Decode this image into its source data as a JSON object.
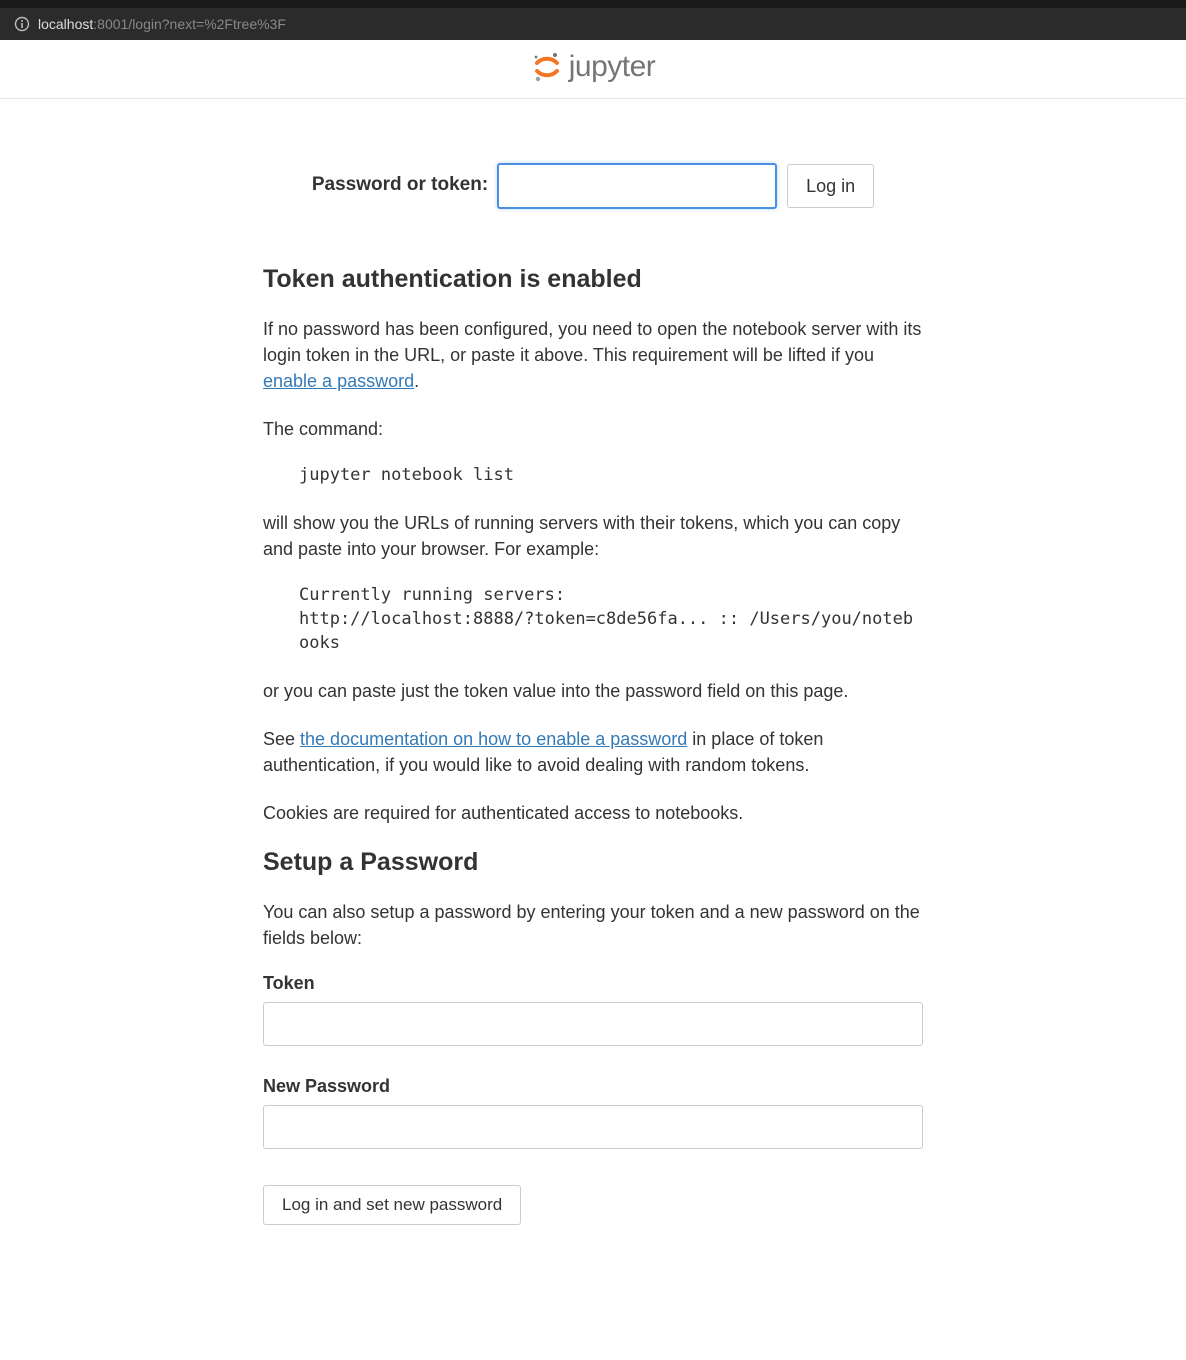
{
  "browser": {
    "url_host": "localhost",
    "url_path": ":8001/login?next=%2Ftree%3F"
  },
  "header": {
    "logo_text": "jupyter"
  },
  "login_form": {
    "label": "Password or token:",
    "input_value": "",
    "button_label": "Log in"
  },
  "token_section": {
    "heading": "Token authentication is enabled",
    "p1_a": "If no password has been configured, you need to open the notebook server with its login token in the URL, or paste it above. This requirement will be lifted if you ",
    "p1_link": "enable a password",
    "p1_b": ".",
    "p2": "The command:",
    "code1": "jupyter notebook list",
    "p3": "will show you the URLs of running servers with their tokens, which you can copy and paste into your browser. For example:",
    "code2": "Currently running servers:\nhttp://localhost:8888/?token=c8de56fa... :: /Users/you/notebooks",
    "p4": "or you can paste just the token value into the password field on this page.",
    "p5_a": "See ",
    "p5_link": "the documentation on how to enable a password",
    "p5_b": " in place of token authentication, if you would like to avoid dealing with random tokens.",
    "p6": "Cookies are required for authenticated access to notebooks."
  },
  "setup_section": {
    "heading": "Setup a Password",
    "intro": "You can also setup a password by entering your token and a new password on the fields below:",
    "token_label": "Token",
    "token_value": "",
    "newpwd_label": "New Password",
    "newpwd_value": "",
    "button_label": "Log in and set new password"
  }
}
